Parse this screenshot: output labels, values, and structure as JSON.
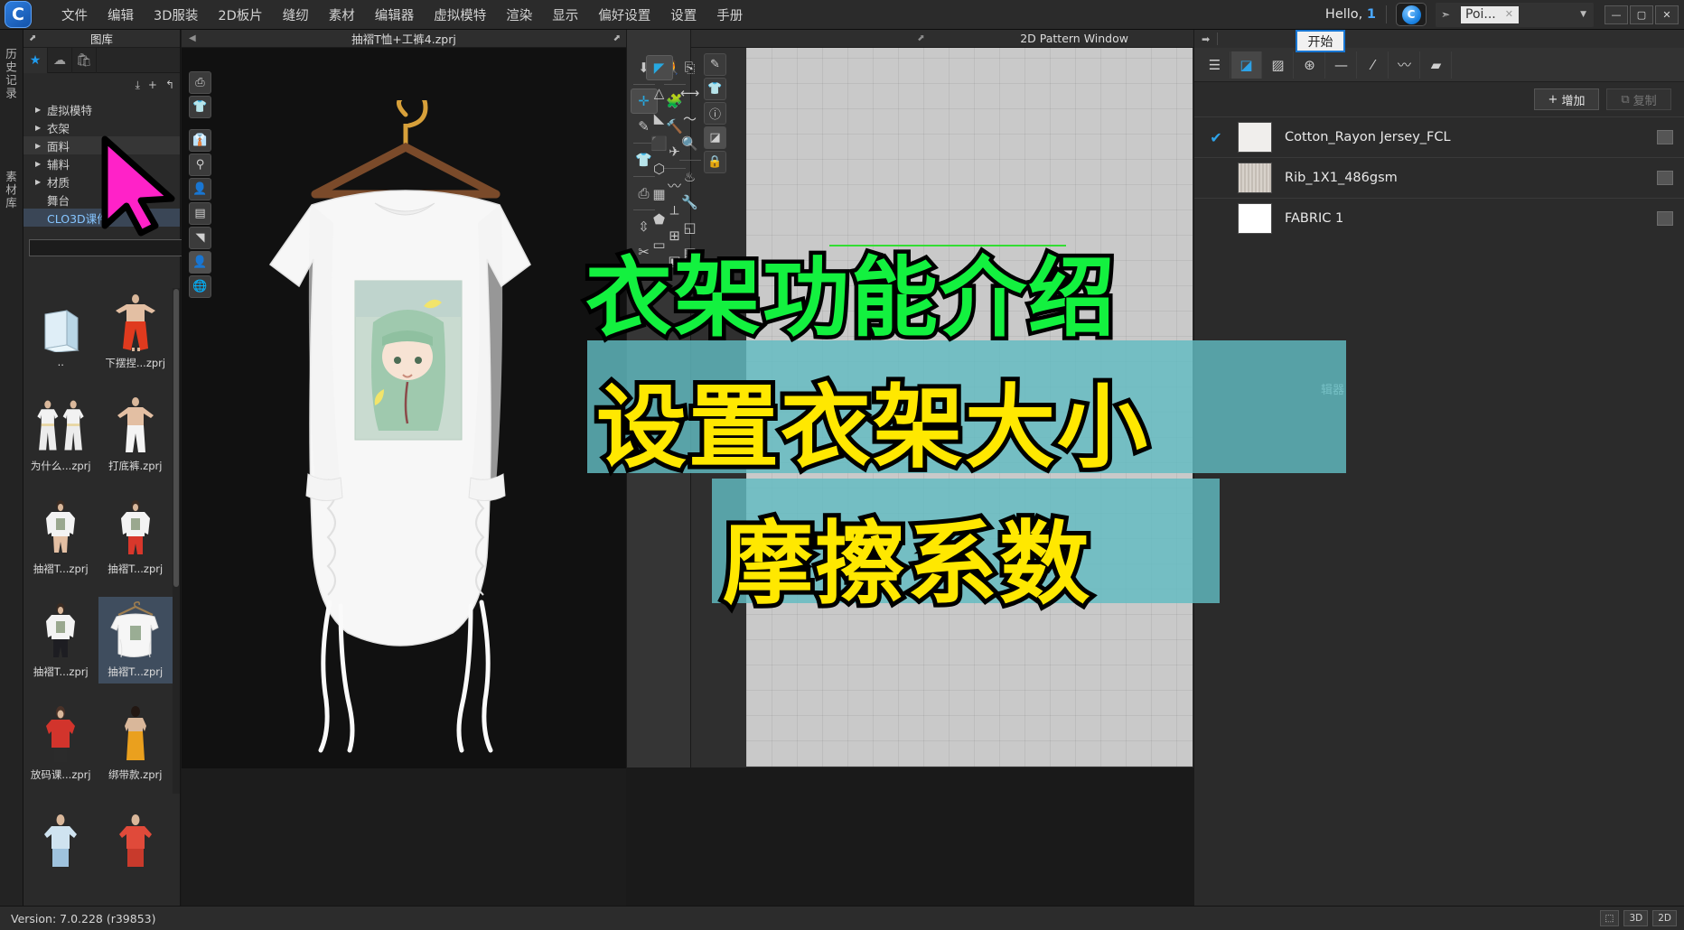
{
  "app": {
    "logo_letter": "C",
    "version_text": "Version: 7.0.228 (r39853)"
  },
  "menubar": {
    "items": [
      {
        "label": "文件",
        "name": "menu-file"
      },
      {
        "label": "编辑",
        "name": "menu-edit"
      },
      {
        "label": "3D服装",
        "name": "menu-3d-garment"
      },
      {
        "label": "2D板片",
        "name": "menu-2d-pattern"
      },
      {
        "label": "缝纫",
        "name": "menu-sewing"
      },
      {
        "label": "素材",
        "name": "menu-material"
      },
      {
        "label": "编辑器",
        "name": "menu-editor"
      },
      {
        "label": "虚拟模特",
        "name": "menu-avatar"
      },
      {
        "label": "渲染",
        "name": "menu-render"
      },
      {
        "label": "显示",
        "name": "menu-display"
      },
      {
        "label": "偏好设置",
        "name": "menu-preferences"
      },
      {
        "label": "设置",
        "name": "menu-settings"
      },
      {
        "label": "手册",
        "name": "menu-manual"
      }
    ],
    "hello_prefix": "Hello,",
    "hello_user": "1",
    "cloud_letter": "C",
    "poi_label": "Poi...",
    "poi_close": "✕",
    "caret": "▼",
    "win_min": "—",
    "win_max": "▢",
    "win_close": "✕",
    "start_popup": "开始"
  },
  "edge_tabs": [
    {
      "label": "历史记录",
      "name": "edge-tab-history"
    },
    {
      "label": "素材库",
      "name": "edge-tab-material-library"
    }
  ],
  "library": {
    "title": "图库",
    "popout_icon": "⬈",
    "tabs": [
      {
        "icon": "★",
        "name": "library-tab-favorites",
        "active": true
      },
      {
        "icon": "☁",
        "name": "library-tab-cloud",
        "active": false
      },
      {
        "icon": "🛍",
        "name": "library-tab-store",
        "active": false
      }
    ],
    "tools": [
      {
        "icon": "⤓",
        "name": "library-download-icon"
      },
      {
        "icon": "+",
        "name": "library-add-icon"
      },
      {
        "icon": "↰",
        "name": "library-back-icon"
      }
    ],
    "tree": [
      {
        "label": "虚拟模特",
        "name": "tree-item-avatar",
        "arrow": "▶",
        "state": ""
      },
      {
        "label": "衣架",
        "name": "tree-item-hanger",
        "arrow": "▶",
        "state": ""
      },
      {
        "label": "面料",
        "name": "tree-item-fabric",
        "arrow": "▶",
        "state": "hl"
      },
      {
        "label": "辅料",
        "name": "tree-item-trim",
        "arrow": "▶",
        "state": ""
      },
      {
        "label": "材质",
        "name": "tree-item-texture",
        "arrow": "▶",
        "state": ""
      },
      {
        "label": "舞台",
        "name": "tree-item-stage",
        "arrow": "",
        "state": ""
      },
      {
        "label": "CLO3D课件",
        "name": "tree-item-clo3d-courseware",
        "arrow": "",
        "state": "sel"
      }
    ],
    "search": {
      "value": "",
      "placeholder": "",
      "search_icon": "🔍",
      "dropdown_icon": "▾",
      "refresh_icon": "⟳",
      "list_icon": "☰"
    },
    "files": [
      {
        "caption": "..",
        "name": "file-parent-folder",
        "kind": "folder",
        "selected": false
      },
      {
        "caption": "下摆捏...zprj",
        "name": "file-item-1",
        "kind": "avatar-red",
        "selected": false
      },
      {
        "caption": "为什么...zprj",
        "name": "file-item-2",
        "kind": "avatar-pair",
        "selected": false
      },
      {
        "caption": "打底裤.zprj",
        "name": "file-item-3",
        "kind": "avatar-white",
        "selected": false
      },
      {
        "caption": "抽褶T...zprj",
        "name": "file-item-4",
        "kind": "avatar-top",
        "selected": false
      },
      {
        "caption": "抽褶T...zprj",
        "name": "file-item-5",
        "kind": "avatar-redpants",
        "selected": false
      },
      {
        "caption": "抽褶T...zprj",
        "name": "file-item-6",
        "kind": "avatar-blackpants",
        "selected": false
      },
      {
        "caption": "抽褶T...zprj",
        "name": "file-item-7",
        "kind": "hanger-shirt",
        "selected": true
      },
      {
        "caption": "放码课...zprj",
        "name": "file-item-8",
        "kind": "avatar-redshirt",
        "selected": false
      },
      {
        "caption": "绑带款.zprj",
        "name": "file-item-9",
        "kind": "avatar-orange",
        "selected": false
      },
      {
        "caption": "",
        "name": "file-item-10",
        "kind": "avatar-blue",
        "selected": false
      },
      {
        "caption": "",
        "name": "file-item-11",
        "kind": "avatar-red2",
        "selected": false
      }
    ]
  },
  "viewport3d": {
    "title": "抽褶T恤+工裤4.zprj",
    "popout_icon": "⬈",
    "back_arrow": "◀",
    "tools": [
      {
        "icon": "⎙",
        "name": "tool-3d-print",
        "active": false
      },
      {
        "icon": "👕",
        "name": "tool-3d-garment-show",
        "active": false
      },
      {
        "icon": "👔",
        "name": "tool-3d-garment-toggle",
        "active": false
      },
      {
        "icon": "⚲",
        "name": "tool-3d-pin",
        "active": false
      },
      {
        "icon": "👤",
        "name": "tool-3d-avatar",
        "active": false
      },
      {
        "icon": "▤",
        "name": "tool-3d-surface",
        "active": false
      },
      {
        "icon": "◥",
        "name": "tool-3d-shade",
        "active": false
      },
      {
        "icon": "👤",
        "name": "tool-3d-skin",
        "active": true
      },
      {
        "icon": "🌐",
        "name": "tool-3d-environment",
        "active": false
      }
    ]
  },
  "mid_toolbar": {
    "col1": [
      {
        "icon": "⬇",
        "name": "tool-simulate",
        "active": false
      },
      {
        "icon": "✛",
        "name": "tool-transform",
        "active": true
      },
      {
        "icon": "✎",
        "name": "tool-select-mesh",
        "active": false
      },
      {
        "icon": "👕",
        "name": "tool-garment-fit",
        "active": false
      },
      {
        "icon": "⎙",
        "name": "tool-pattern-3d",
        "active": false
      },
      {
        "icon": "⇳",
        "name": "tool-gizmo",
        "active": false
      },
      {
        "icon": "✂",
        "name": "tool-cut",
        "active": false
      },
      {
        "icon": "✒",
        "name": "tool-pen-3d",
        "active": false
      },
      {
        "icon": "↧",
        "name": "tool-drop",
        "active": false
      }
    ],
    "col2": [
      {
        "icon": "🚶",
        "name": "tool-avatar-pose",
        "active": false
      },
      {
        "icon": "🧩",
        "name": "tool-sewing-3d",
        "active": false
      },
      {
        "icon": "🔨",
        "name": "tool-edit-sewing",
        "active": false
      },
      {
        "icon": "✈",
        "name": "tool-arrange",
        "active": false
      },
      {
        "icon": "〰",
        "name": "tool-fold",
        "active": false
      },
      {
        "icon": "⟂",
        "name": "tool-zipper",
        "active": false
      },
      {
        "icon": "⊞",
        "name": "tool-button",
        "active": false
      },
      {
        "icon": "▣",
        "name": "tool-topstitch",
        "active": false
      }
    ],
    "col3": [
      {
        "icon": "◤",
        "name": "tool-2d-select",
        "active": true
      },
      {
        "icon": "△",
        "name": "tool-2d-edit-point",
        "active": false
      },
      {
        "icon": "◣",
        "name": "tool-2d-edit-curve",
        "active": false
      },
      {
        "icon": "⬛",
        "name": "tool-2d-polygon",
        "active": false
      },
      {
        "icon": "⬡",
        "name": "tool-2d-rectangle",
        "active": false
      },
      {
        "icon": "▦",
        "name": "tool-2d-internal-line",
        "active": false
      },
      {
        "icon": "⬟",
        "name": "tool-2d-pleat",
        "active": false
      },
      {
        "icon": "▭",
        "name": "tool-2d-grade",
        "active": false
      },
      {
        "icon": "▥",
        "name": "tool-2d-layout",
        "active": false
      }
    ],
    "col4": [
      {
        "icon": "⎘",
        "name": "tool-2d-copy",
        "active": false
      },
      {
        "icon": "⟷",
        "name": "tool-2d-measure",
        "active": false
      },
      {
        "icon": "〜",
        "name": "tool-2d-curve",
        "active": false
      },
      {
        "icon": "🔍",
        "name": "tool-2d-zoom",
        "active": false
      },
      {
        "icon": "♨",
        "name": "tool-2d-iron",
        "active": false
      },
      {
        "icon": "🔧",
        "name": "tool-2d-settings",
        "active": false
      },
      {
        "icon": "◱",
        "name": "tool-2d-fold-arrange",
        "active": false
      },
      {
        "icon": "▤",
        "name": "tool-2d-grid",
        "active": false
      }
    ]
  },
  "pattern_window": {
    "title": "2D Pattern Window",
    "popout_icon": "⬈",
    "tools": [
      {
        "icon": "✎",
        "name": "tool-pattern-pen",
        "active": false
      },
      {
        "icon": "👕",
        "name": "tool-pattern-show-garment",
        "active": false
      },
      {
        "icon": "ⓘ",
        "name": "tool-pattern-info",
        "active": false
      },
      {
        "icon": "◪",
        "name": "tool-pattern-fabric",
        "active": true
      },
      {
        "icon": "🔒",
        "name": "tool-pattern-lock",
        "active": false
      }
    ]
  },
  "right_panel": {
    "top_arrow": "➡",
    "icons": [
      {
        "icon": "☰",
        "name": "rp-icon-list",
        "active": false
      },
      {
        "icon": "◪",
        "name": "rp-icon-fabric",
        "active": true
      },
      {
        "icon": "▨",
        "name": "rp-icon-texture",
        "active": false
      },
      {
        "icon": "⊛",
        "name": "rp-icon-button",
        "active": false
      },
      {
        "icon": "—",
        "name": "rp-icon-line",
        "active": false
      },
      {
        "icon": "⁄",
        "name": "rp-icon-topstitch",
        "active": false
      },
      {
        "icon": "〰",
        "name": "rp-icon-zigzag",
        "active": false
      },
      {
        "icon": "▰",
        "name": "rp-icon-trim",
        "active": false
      }
    ],
    "add_label": "增加",
    "add_plus": "+",
    "duplicate_label": "复制",
    "duplicate_icon": "⧉",
    "fabrics": [
      {
        "name_text": "Cotton_Rayon Jersey_FCL",
        "checked": true,
        "swatch": "#f0eeec",
        "item_name": "fabric-row-cotton-rayon-jersey"
      },
      {
        "name_text": "Rib_1X1_486gsm",
        "checked": false,
        "swatch": "#cfc9c2",
        "item_name": "fabric-row-rib-1x1-486gsm"
      },
      {
        "name_text": "FABRIC 1",
        "checked": false,
        "swatch": "#ffffff",
        "item_name": "fabric-row-fabric-1"
      }
    ],
    "editor_label": "辑器"
  },
  "overlay": {
    "line1": "衣架功能介绍",
    "line2": "设置衣架大小",
    "line3": "摩擦系数",
    "line1_color": "#13f13f",
    "line2_color": "#ffe800",
    "line3_color": "#ffe800",
    "band_color": "#62bcc2"
  },
  "statusbar": {
    "chips": [
      "⬚",
      "3D",
      "2D"
    ]
  }
}
